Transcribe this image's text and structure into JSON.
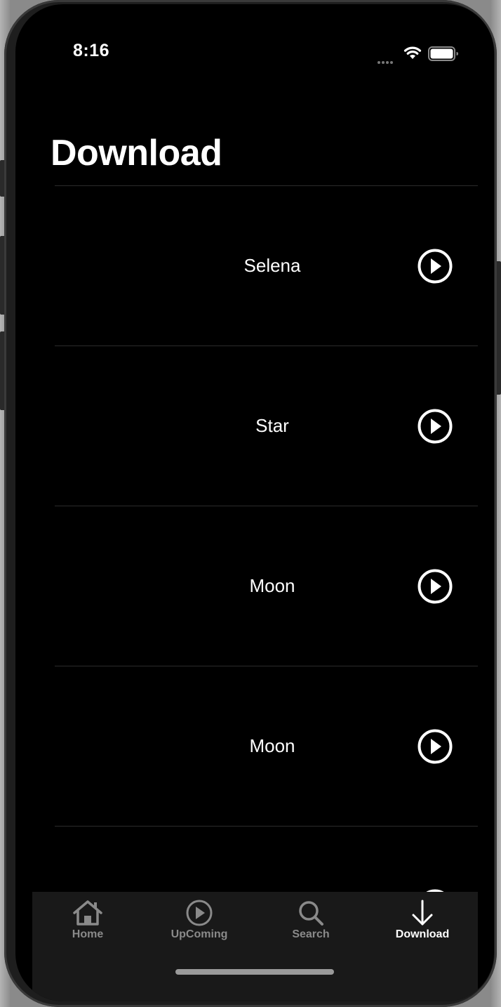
{
  "status_bar": {
    "time": "8:16"
  },
  "header": {
    "title": "Download"
  },
  "downloads": [
    {
      "title": "Selena"
    },
    {
      "title": "Star"
    },
    {
      "title": "Moon"
    },
    {
      "title": "Moon"
    },
    {
      "title": ""
    }
  ],
  "tab_bar": {
    "tabs": [
      {
        "label": "Home",
        "icon": "house-icon"
      },
      {
        "label": "UpComing",
        "icon": "play-circle-icon"
      },
      {
        "label": "Search",
        "icon": "search-icon"
      },
      {
        "label": "Download",
        "icon": "download-arrow-icon"
      }
    ],
    "active_tab": "Download"
  },
  "colors": {
    "background": "#000000",
    "text": "#ffffff",
    "tab_inactive": "#8a8a8a",
    "tab_bar_bg": "#191919"
  }
}
